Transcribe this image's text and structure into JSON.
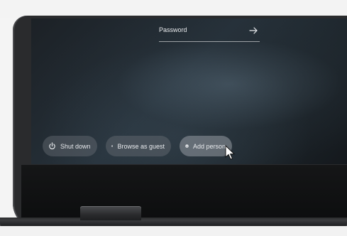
{
  "login": {
    "password_placeholder": "Password",
    "submit_icon": "arrow-right-icon"
  },
  "shelf": {
    "buttons": [
      {
        "label": "Shut down",
        "icon": "power-icon"
      },
      {
        "label": "Browse as guest",
        "icon": "account-circle-icon"
      },
      {
        "label": "Add person",
        "icon": "add-person-icon"
      }
    ]
  },
  "colors": {
    "text": "#e8eaed",
    "button_bg": "#6e737a"
  }
}
